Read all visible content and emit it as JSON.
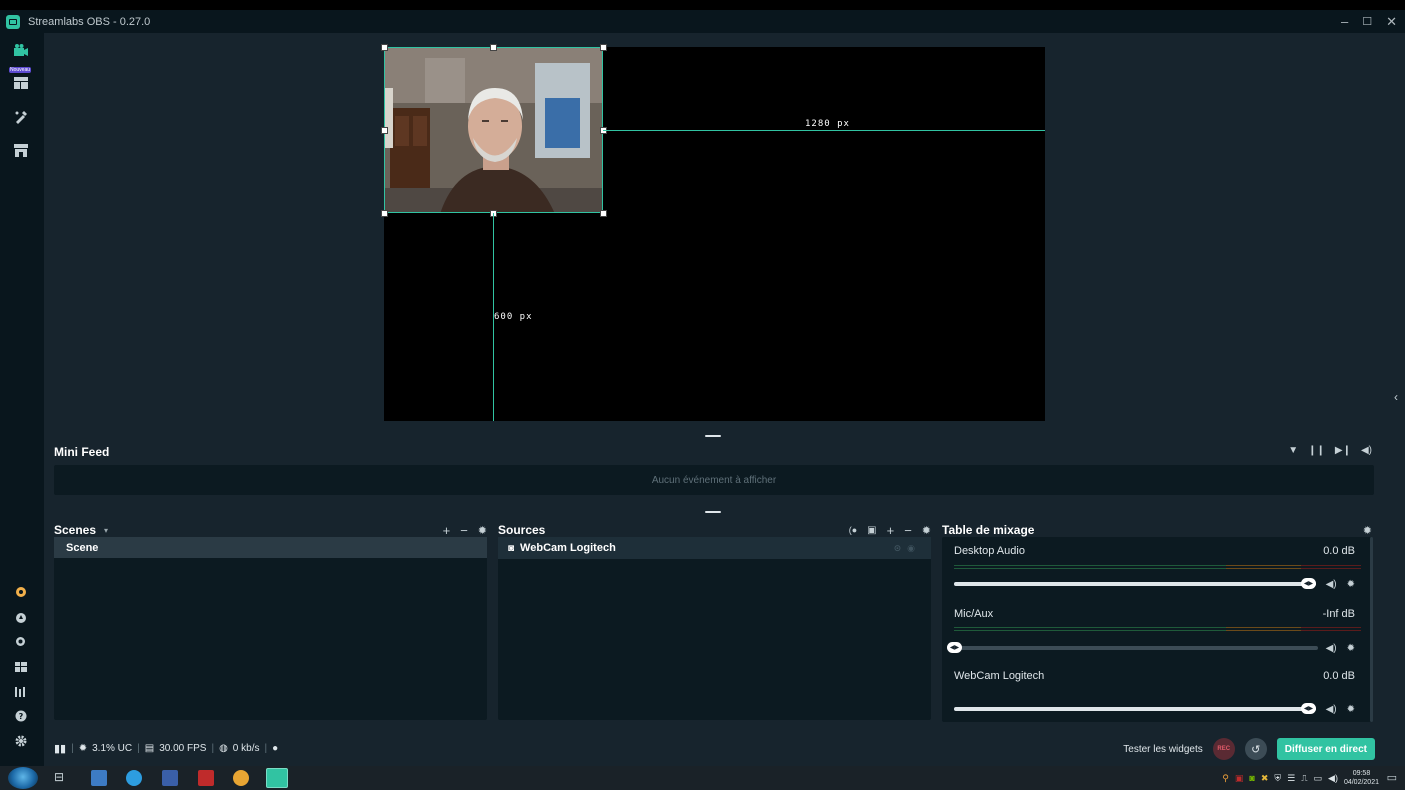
{
  "window": {
    "title": "Streamlabs OBS - 0.27.0",
    "controls": [
      "–",
      "☐",
      "✕"
    ]
  },
  "sidebar": {
    "new_badge": "Nouveau",
    "top_icons": [
      "studio-mode-icon",
      "layout-editor-icon",
      "themes-icon",
      "app-store-icon"
    ],
    "bottom_icons": [
      "highlight-icon",
      "dashboard-icon",
      "search-icon",
      "apps-icon",
      "stats-icon",
      "help-icon",
      "settings-icon"
    ]
  },
  "preview": {
    "width_label": "1280 px",
    "height_label": "600 px"
  },
  "mini_feed": {
    "title": "Mini Feed",
    "empty_text": "Aucun événement à afficher"
  },
  "scenes": {
    "title": "Scenes",
    "items": [
      "Scene"
    ]
  },
  "sources": {
    "title": "Sources",
    "items": [
      "WebCam Logitech"
    ]
  },
  "mixer": {
    "title": "Table de mixage",
    "channels": [
      {
        "name": "Desktop Audio",
        "db": "0.0 dB",
        "level": 1.0
      },
      {
        "name": "Mic/Aux",
        "db": "-Inf dB",
        "level": 0.0
      },
      {
        "name": "WebCam Logitech",
        "db": "0.0 dB",
        "level": 1.0
      }
    ]
  },
  "footer": {
    "cpu": "3.1% UC",
    "fps": "30.00 FPS",
    "bitrate": "0 kb/s",
    "test_widgets": "Tester les widgets",
    "rec": "REC",
    "go_live": "Diffuser en direct"
  },
  "taskbar": {
    "time": "09:58",
    "date": "04/02/2021"
  },
  "colors": {
    "accent": "#31c3a2",
    "bg": "#17242d",
    "panel": "#0c1a21",
    "sidebar": "#09161d"
  }
}
